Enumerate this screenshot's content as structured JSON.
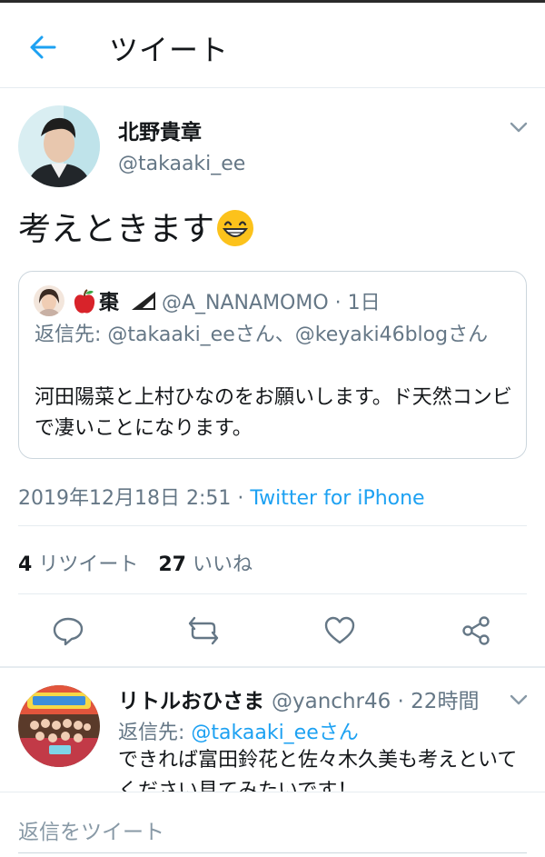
{
  "header": {
    "title": "ツイート"
  },
  "tweet": {
    "author_name": "北野貴章",
    "author_handle": "@takaaki_ee",
    "text": "考えときます",
    "timestamp": "2019年12月18日 2:51",
    "meta_separator": " · ",
    "source": "Twitter for iPhone",
    "retweets_count": "4",
    "retweets_label": "リツイート",
    "likes_count": "27",
    "likes_label": "いいね"
  },
  "quoted_tweet": {
    "author_name": "棗",
    "handle_time": "@A_NANAMOMO · 1日",
    "reply_to": "返信先: @takaaki_eeさん、@keyaki46blogさん",
    "text": "河田陽菜と上村ひなのをお願いします。ド天然コンビで凄いことになります。"
  },
  "reply": {
    "author_name": "リトルおひさま",
    "handle_time": "@yanchr46 · 22時間",
    "reply_to_label": "返信先: ",
    "reply_to_link": "@takaaki_eeさん",
    "text": "できれば富田鈴花と佐々木久美も考えといてください見てみたいです！"
  },
  "compose": {
    "placeholder": "返信をツイート"
  },
  "colors": {
    "accent": "#1da1f2",
    "text": "#14171a",
    "secondary": "#657786",
    "border": "#e6ecf0"
  }
}
